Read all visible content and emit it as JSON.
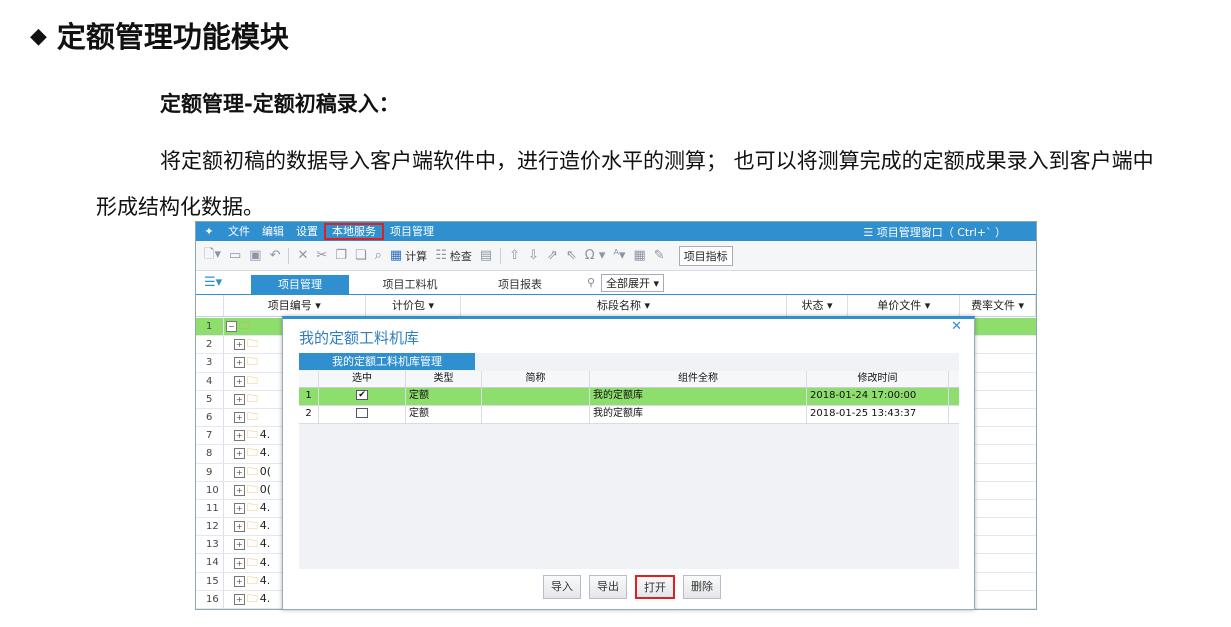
{
  "slide": {
    "title": "定额管理功能模块",
    "subheading": "定额管理-定额初稿录入：",
    "body": "将定额初稿的数据导入客户端软件中，进行造价水平的测算； 也可以将测算完成的定额成果录入到客户端中形成结构化数据。"
  },
  "menubar": {
    "items": [
      "文件",
      "编辑",
      "设置",
      "本地服务",
      "项目管理"
    ],
    "window_title": "☰ 项目管理窗口（ Ctrl+` ）"
  },
  "toolbar": {
    "calc_label": "计算",
    "check_label": "检查",
    "omega": "Ω ▾",
    "project_index": "项目指标"
  },
  "tabs": [
    "项目管理",
    "项目工料机",
    "项目报表"
  ],
  "expand_all": "全部展开",
  "columns": [
    "项目编号",
    "计价包",
    "标段名称",
    "状态",
    "单价文件",
    "费率文件"
  ],
  "grid_rows": [
    {
      "num": "1",
      "sel": true
    },
    {
      "num": "2"
    },
    {
      "num": "3"
    },
    {
      "num": "4"
    },
    {
      "num": "5"
    },
    {
      "num": "6"
    },
    {
      "num": "7",
      "code": "4."
    },
    {
      "num": "8",
      "code": "4."
    },
    {
      "num": "9",
      "code": "0("
    },
    {
      "num": "10",
      "code": "0("
    },
    {
      "num": "11",
      "code": "4."
    },
    {
      "num": "12",
      "code": "4."
    },
    {
      "num": "13",
      "code": "4."
    },
    {
      "num": "14",
      "code": "4."
    },
    {
      "num": "15",
      "code": "4."
    },
    {
      "num": "16",
      "code": "4."
    }
  ],
  "dialog": {
    "title": "我的定额工料机库",
    "tab": "我的定额工料机库管理",
    "columns": [
      "选中",
      "类型",
      "简称",
      "组件全称",
      "修改时间"
    ],
    "rows": [
      {
        "num": "1",
        "checked": "✔",
        "type": "定额",
        "short": "",
        "full": "我的定额库",
        "time": "2018-01-24 17:00:00"
      },
      {
        "num": "2",
        "checked": "",
        "type": "定额",
        "short": "",
        "full": "我的定额库",
        "time": "2018-01-25 13:43:37"
      }
    ],
    "buttons": [
      "导入",
      "导出",
      "打开",
      "删除"
    ]
  },
  "colors": {
    "accent": "#2f8fcf",
    "selected_row": "#8ede6e",
    "highlight": "#e02020"
  }
}
